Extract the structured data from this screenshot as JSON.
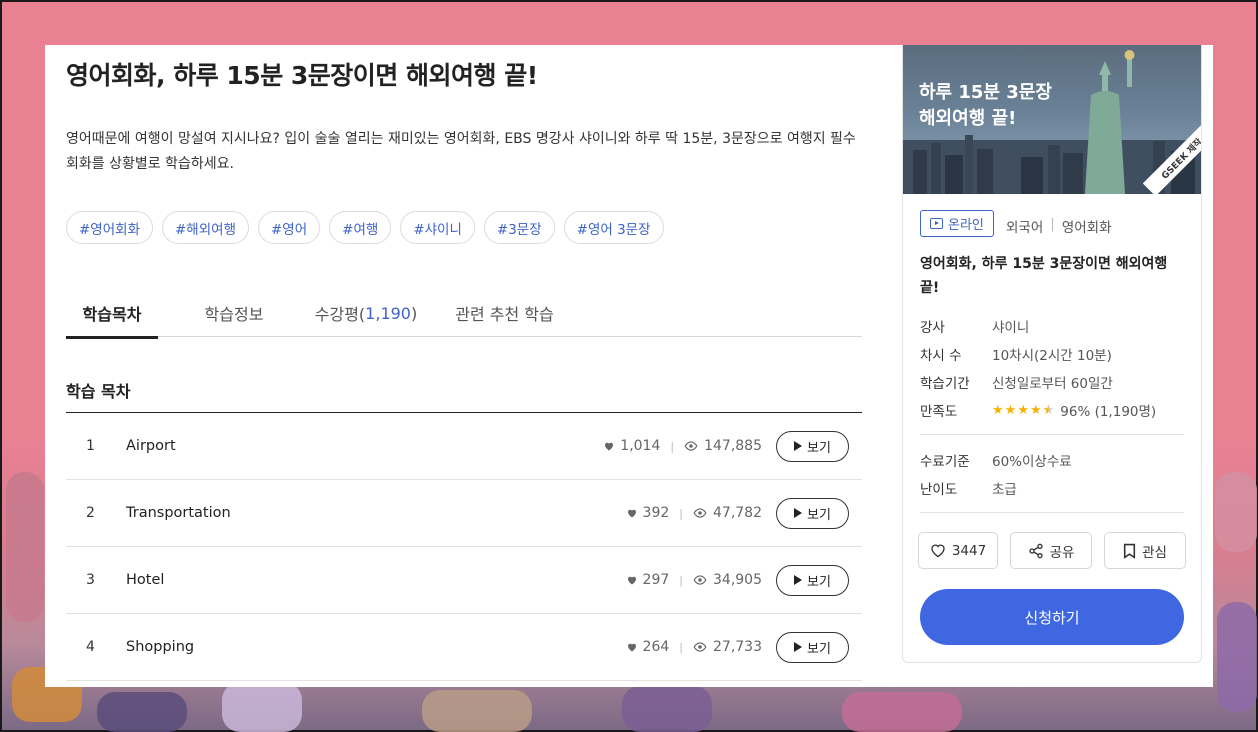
{
  "course": {
    "title": "영어회화, 하루 15분 3문장이면 해외여행 끝!",
    "description": "영어때문에 여행이 망설여 지시나요? 입이 술술 열리는 재미있는 영어회화, EBS 명강사 샤이니와 하루 딱 15분, 3문장으로 여행지 필수회화를 상황별로 학습하세요.",
    "tags": [
      "#영어회화",
      "#해외여행",
      "#영어",
      "#여행",
      "#샤이니",
      "#3문장",
      "#영어 3문장"
    ]
  },
  "tabs": [
    {
      "label": "학습목차",
      "count": ""
    },
    {
      "label": "학습정보",
      "count": ""
    },
    {
      "label": "수강평(",
      "count": "1,190",
      "suffix": ")"
    },
    {
      "label": "관련 추천 학습",
      "count": ""
    }
  ],
  "toc": {
    "title": "학습 목차",
    "button_label": "보기",
    "rows": [
      {
        "num": "1",
        "name": "Airport",
        "likes": "1,014",
        "views": "147,885"
      },
      {
        "num": "2",
        "name": "Transportation",
        "likes": "392",
        "views": "47,782"
      },
      {
        "num": "3",
        "name": "Hotel",
        "likes": "297",
        "views": "34,905"
      },
      {
        "num": "4",
        "name": "Shopping",
        "likes": "264",
        "views": "27,733"
      }
    ]
  },
  "side": {
    "thumb_line1": "하루 15분 3문장",
    "thumb_line2": "해외여행 끝!",
    "thumb_badge": "GSEEK 제작",
    "online_label": "온라인",
    "category1": "외국어",
    "category2": "영어회화",
    "title": "영어회화, 하루 15분 3문장이면 해외여행 끝!",
    "info": [
      {
        "k": "강사",
        "v": "샤이니"
      },
      {
        "k": "차시 수",
        "v": "10차시(2시간 10분)"
      },
      {
        "k": "학습기간",
        "v": "신청일로부터 60일간"
      },
      {
        "k": "만족도",
        "v": "96% (1,190명)"
      }
    ],
    "rating_stars": 4.5,
    "info2": [
      {
        "k": "수료기준",
        "v": "60%이상수료"
      },
      {
        "k": "난이도",
        "v": "초급"
      }
    ],
    "like_count": "3447",
    "share_label": "공유",
    "bookmark_label": "관심",
    "apply_label": "신청하기"
  },
  "colors": {
    "accent": "#3f67e2",
    "link": "#3e63c8",
    "star": "#f5b301",
    "backdrop": "#e98193"
  }
}
